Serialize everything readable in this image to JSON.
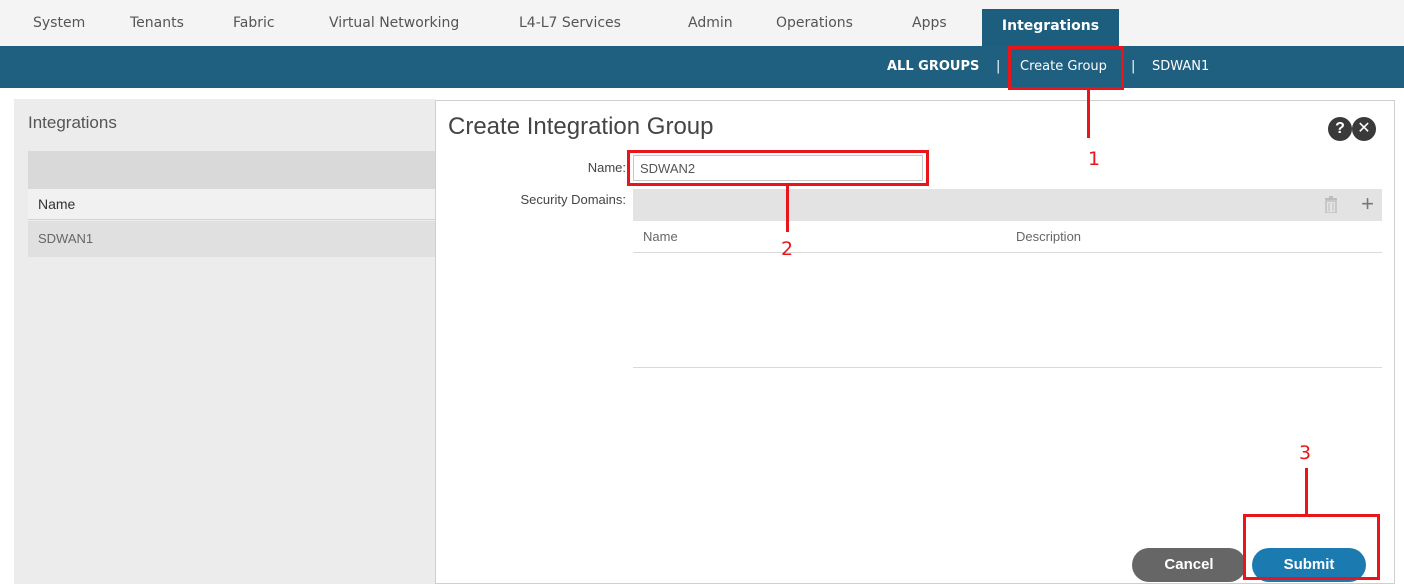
{
  "top_nav": {
    "tabs": [
      "System",
      "Tenants",
      "Fabric",
      "Virtual Networking",
      "L4-L7 Services",
      "Admin",
      "Operations",
      "Apps",
      "Integrations"
    ],
    "active_tab": "Integrations"
  },
  "sub_nav": {
    "items": [
      "ALL GROUPS",
      "Create Group",
      "SDWAN1"
    ],
    "separator": "|"
  },
  "left_panel": {
    "title": "Integrations",
    "column_header": "Name",
    "rows": [
      "SDWAN1"
    ]
  },
  "dialog": {
    "title": "Create Integration Group",
    "help_label": "?",
    "close_label": "✕",
    "name_label": "Name:",
    "name_value": "SDWAN2",
    "security_domains_label": "Security Domains:",
    "table_columns": [
      "Name",
      "Description"
    ],
    "cancel_label": "Cancel",
    "submit_label": "Submit"
  },
  "annotations": {
    "labels": [
      "1",
      "2",
      "3"
    ],
    "color": "#e8161b"
  },
  "colors": {
    "header_bar": "#1f5f80",
    "submit": "#1b7bb0",
    "cancel": "#666666"
  }
}
